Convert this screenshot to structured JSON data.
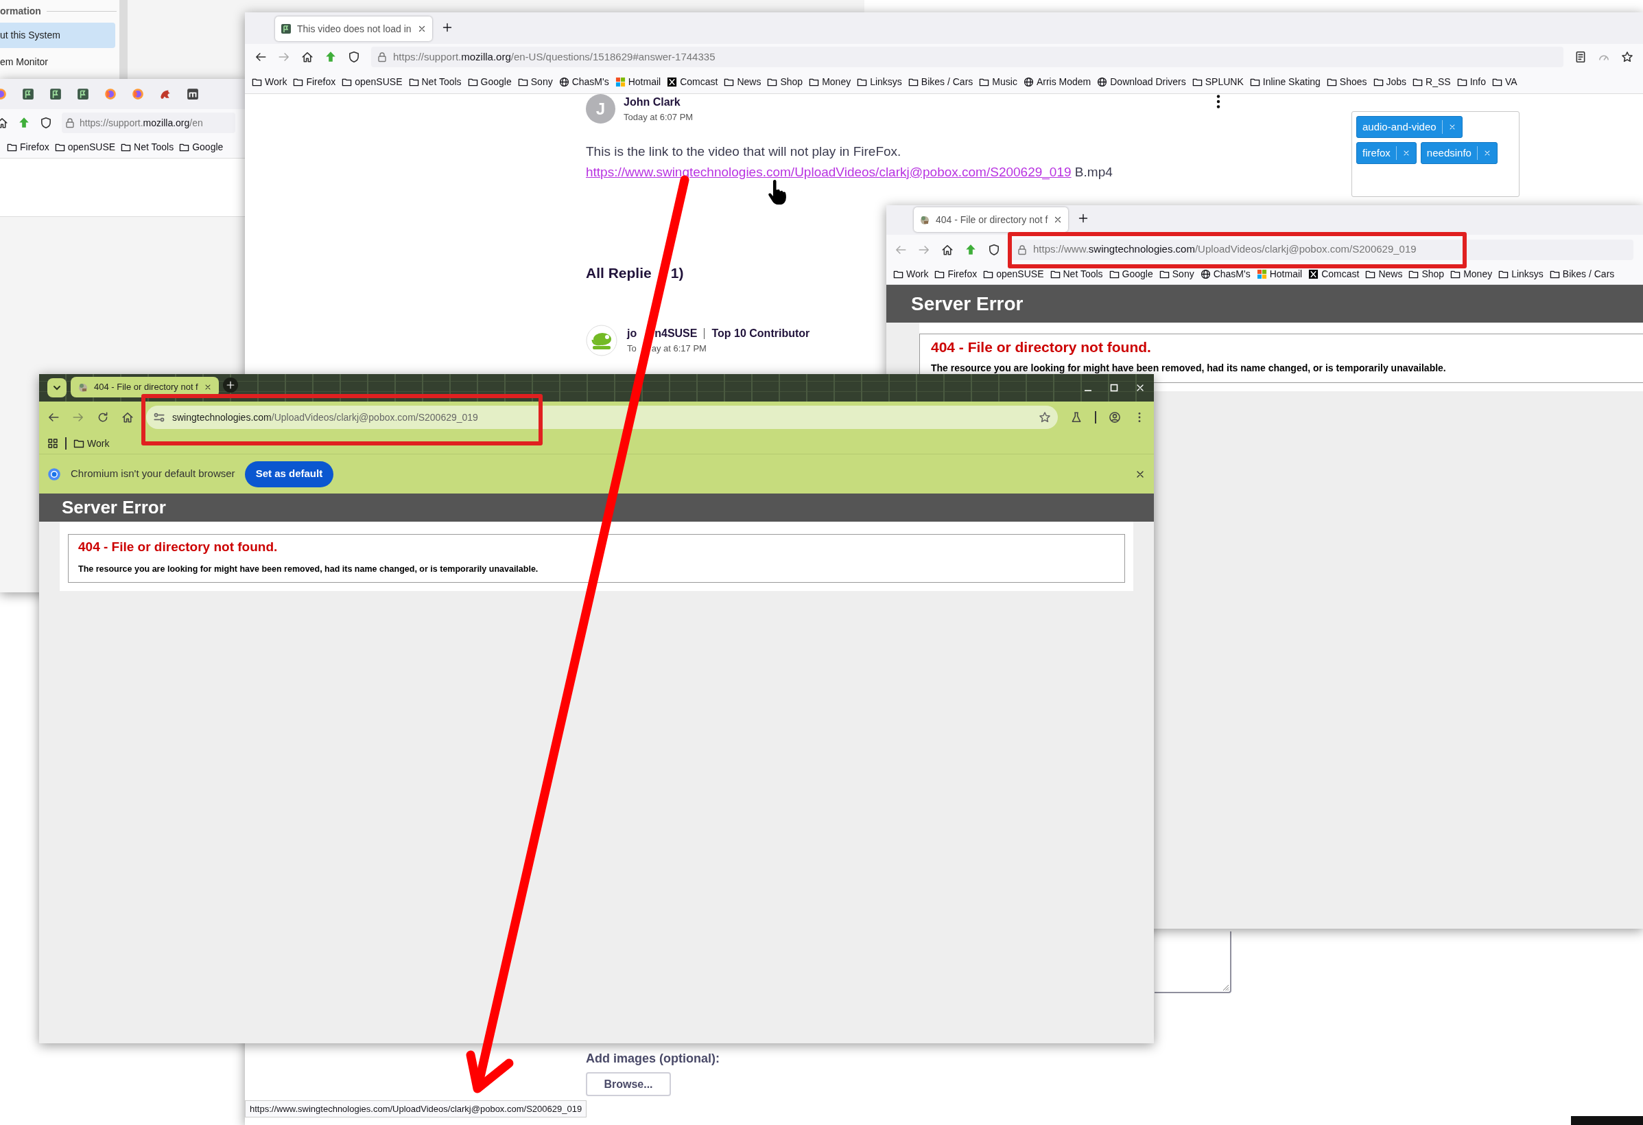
{
  "settings_window": {
    "section_title": "ormation",
    "items": [
      {
        "label": "ut this System",
        "selected": true
      },
      {
        "label": "em Monitor",
        "selected": false
      }
    ]
  },
  "back_browser": {
    "url": {
      "scheme": "https://support.",
      "domain": "mozilla.org",
      "path": "/en"
    },
    "bookmarks": [
      {
        "label": "Firefox",
        "kind": "folder"
      },
      {
        "label": "openSUSE",
        "kind": "folder"
      },
      {
        "label": "Net Tools",
        "kind": "folder"
      },
      {
        "label": "Google",
        "kind": "folder"
      }
    ]
  },
  "main_browser": {
    "tabs": [
      {
        "title": "This video does not load in",
        "selected": true
      }
    ],
    "url": {
      "scheme": "https://support.",
      "domain": "mozilla.org",
      "path": "/en-US/questions/1518629#answer-1744335"
    },
    "bookmarks": [
      {
        "label": "Work",
        "kind": "folder"
      },
      {
        "label": "Firefox",
        "kind": "folder"
      },
      {
        "label": "openSUSE",
        "kind": "folder"
      },
      {
        "label": "Net Tools",
        "kind": "folder"
      },
      {
        "label": "Google",
        "kind": "folder"
      },
      {
        "label": "Sony",
        "kind": "folder"
      },
      {
        "label": "ChasM's",
        "kind": "globe"
      },
      {
        "label": "Hotmail",
        "kind": "windows"
      },
      {
        "label": "Comcast",
        "kind": "x"
      },
      {
        "label": "News",
        "kind": "folder"
      },
      {
        "label": "Shop",
        "kind": "folder"
      },
      {
        "label": "Money",
        "kind": "folder"
      },
      {
        "label": "Linksys",
        "kind": "folder"
      },
      {
        "label": "Bikes / Cars",
        "kind": "folder"
      },
      {
        "label": "Music",
        "kind": "folder"
      },
      {
        "label": "Arris Modem",
        "kind": "globe"
      },
      {
        "label": "Download Drivers",
        "kind": "globe"
      },
      {
        "label": "SPLUNK",
        "kind": "folder"
      },
      {
        "label": "Inline Skating",
        "kind": "folder"
      },
      {
        "label": "Shoes",
        "kind": "folder"
      },
      {
        "label": "Jobs",
        "kind": "folder"
      },
      {
        "label": "R_SS",
        "kind": "folder"
      },
      {
        "label": "Info",
        "kind": "folder"
      },
      {
        "label": "VA",
        "kind": "folder"
      }
    ],
    "question": {
      "initial": "J",
      "author": "John Clark",
      "time": "Today at 6:07 PM",
      "text": "This is the link to the video that will not play in FireFox.",
      "link": "https://www.swingtechnologies.com/UploadVideos/clarkj@pobox.com/S200629_019",
      "link_suffix": "B.mp4"
    },
    "tags": [
      "audio-and-video",
      "firefox",
      "needsinfo"
    ],
    "replies_heading": [
      "All Replie",
      "1)"
    ],
    "reply": {
      "author": [
        "jo",
        "n4SUSE"
      ],
      "rank": "Top 10 Contributor",
      "time": [
        "To",
        "ay at 6:17 PM"
      ]
    },
    "add_images_label": "Add images (optional):",
    "browse_button": "Browse...",
    "status_url": "https://www.swingtechnologies.com/UploadVideos/clarkj@pobox.com/S200629_019"
  },
  "error_browser": {
    "tabs": [
      {
        "title": "404 - File or directory not f",
        "selected": true
      }
    ],
    "url": {
      "scheme": "https://www.",
      "domain": "swingtechnologies.com",
      "path": "/UploadVideos/clarkj@pobox.com/S200629_019"
    },
    "bookmarks": [
      {
        "label": "Work",
        "kind": "folder"
      },
      {
        "label": "Firefox",
        "kind": "folder"
      },
      {
        "label": "openSUSE",
        "kind": "folder"
      },
      {
        "label": "Net Tools",
        "kind": "folder"
      },
      {
        "label": "Google",
        "kind": "folder"
      },
      {
        "label": "Sony",
        "kind": "folder"
      },
      {
        "label": "ChasM's",
        "kind": "globe"
      },
      {
        "label": "Hotmail",
        "kind": "windows"
      },
      {
        "label": "Comcast",
        "kind": "x"
      },
      {
        "label": "News",
        "kind": "folder"
      },
      {
        "label": "Shop",
        "kind": "folder"
      },
      {
        "label": "Money",
        "kind": "folder"
      },
      {
        "label": "Linksys",
        "kind": "folder"
      },
      {
        "label": "Bikes / Cars",
        "kind": "folder"
      }
    ],
    "page": {
      "header": "Server Error",
      "error_title": "404 - File or directory not found.",
      "error_text": "The resource you are looking for might have been removed, had its name changed, or is temporarily unavailable."
    }
  },
  "chromium": {
    "tabs": [
      {
        "title": "404 - File or directory not f",
        "selected": true
      }
    ],
    "url": {
      "domain": "swingtechnologies.com",
      "path": "/UploadVideos/clarkj@pobox.com/S200629_019"
    },
    "bookmarks": [
      {
        "label": "Work",
        "kind": "folder"
      }
    ],
    "infobar": {
      "message": "Chromium isn't your default browser",
      "button": "Set as default"
    },
    "page": {
      "header": "Server Error",
      "error_title": "404 - File or directory not found.",
      "error_text": "The resource you are looking for might have been removed, had its name changed, or is temporarily unavailable."
    }
  }
}
